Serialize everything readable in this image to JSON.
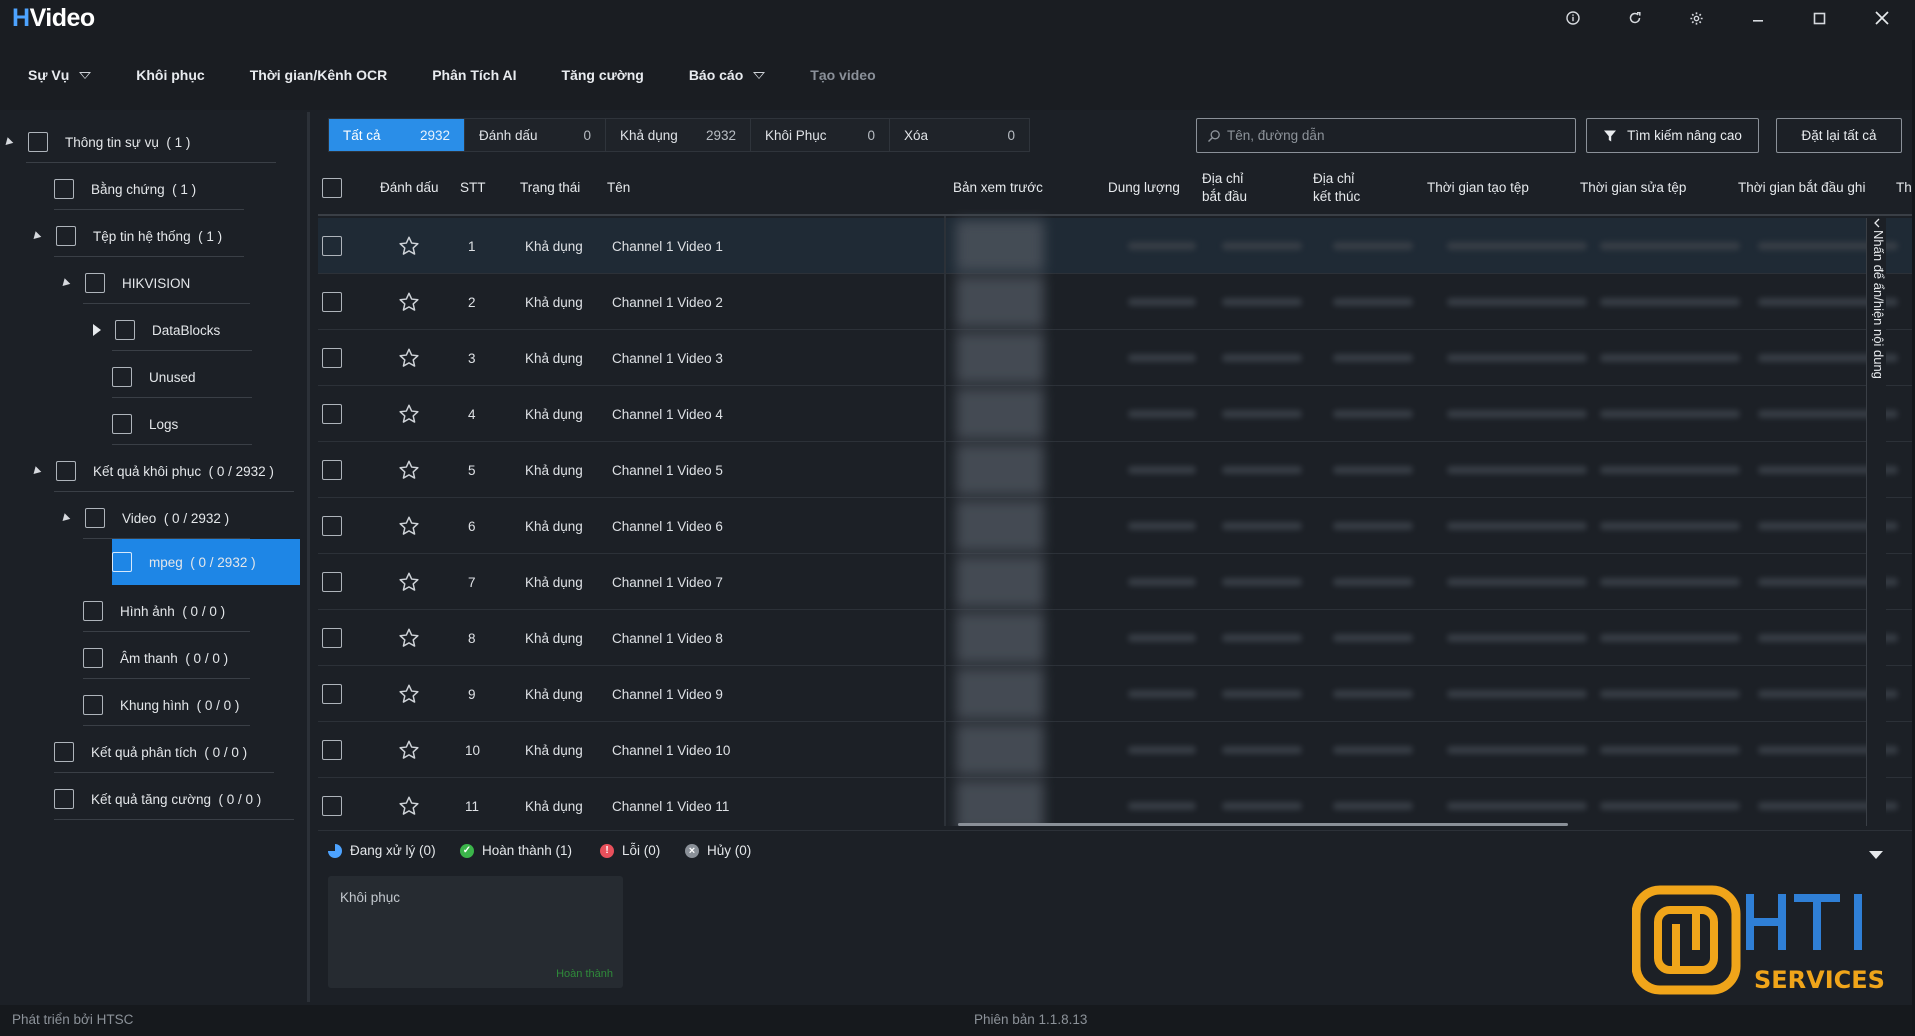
{
  "app": {
    "logo_prefix": "H",
    "logo_rest": "Video"
  },
  "window_controls": [
    "info-icon",
    "refresh-icon",
    "settings-icon",
    "minimize-icon",
    "maximize-icon",
    "close-icon"
  ],
  "menu": {
    "items": [
      {
        "label": "Sự Vụ",
        "dropdown": true
      },
      {
        "label": "Khôi phục",
        "dropdown": false
      },
      {
        "label": "Thời gian/Kênh OCR",
        "dropdown": false
      },
      {
        "label": "Phân Tích AI",
        "dropdown": false
      },
      {
        "label": "Tăng cường",
        "dropdown": false
      },
      {
        "label": "Báo cáo",
        "dropdown": true
      },
      {
        "label": "Tạo video",
        "dropdown": false,
        "disabled": true
      }
    ]
  },
  "tree": {
    "items": [
      {
        "label": "Thông tin sự vụ",
        "count": "( 1 )"
      },
      {
        "label": "Bằng chứng",
        "count": "( 1 )"
      },
      {
        "label": "Tệp tin hệ thống",
        "count": "( 1 )"
      },
      {
        "label": "HIKVISION",
        "count": ""
      },
      {
        "label": "DataBlocks",
        "count": ""
      },
      {
        "label": "Unused",
        "count": ""
      },
      {
        "label": "Logs",
        "count": ""
      },
      {
        "label": "Kết quả khôi phục",
        "count": "( 0 / 2932 )"
      },
      {
        "label": "Video",
        "count": "( 0 / 2932 )"
      },
      {
        "label": "mpeg",
        "count": "( 0 / 2932 )"
      },
      {
        "label": "Hình ảnh",
        "count": "( 0 / 0 )"
      },
      {
        "label": "Âm thanh",
        "count": "( 0 / 0 )"
      },
      {
        "label": "Khung hình",
        "count": "( 0 / 0 )"
      },
      {
        "label": "Kết quả phân tích",
        "count": "( 0 / 0 )"
      },
      {
        "label": "Kết quả tăng cường",
        "count": "( 0 / 0 )"
      }
    ]
  },
  "filters": [
    {
      "label": "Tất cả",
      "count": "2932",
      "active": true
    },
    {
      "label": "Đánh dấu",
      "count": "0"
    },
    {
      "label": "Khả dụng",
      "count": "2932"
    },
    {
      "label": "Khôi Phục",
      "count": "0"
    },
    {
      "label": "Xóa",
      "count": "0"
    }
  ],
  "search": {
    "placeholder": "Tên, đường dẫn"
  },
  "buttons": {
    "advanced_search": "Tìm kiếm nâng cao",
    "reset_all": "Đặt lại tất cả"
  },
  "table": {
    "headers": {
      "mark": "Đánh dấu",
      "stt": "STT",
      "status": "Trạng thái",
      "name": "Tên",
      "preview": "Bản xem trước",
      "size": "Dung lượng",
      "start_addr_1": "Địa chỉ",
      "start_addr_2": "bắt đầu",
      "end_addr_1": "Địa chỉ",
      "end_addr_2": "kết thúc",
      "created": "Thời gian tạo tệp",
      "modified": "Thời gian sửa tệp",
      "rec_start": "Thời gian bắt đầu ghi",
      "more": "Th"
    },
    "rows": [
      {
        "stt": "1",
        "status": "Khả dụng",
        "name": "Channel 1 Video 1"
      },
      {
        "stt": "2",
        "status": "Khả dụng",
        "name": "Channel 1 Video 2"
      },
      {
        "stt": "3",
        "status": "Khả dụng",
        "name": "Channel 1 Video 3"
      },
      {
        "stt": "4",
        "status": "Khả dụng",
        "name": "Channel 1 Video 4"
      },
      {
        "stt": "5",
        "status": "Khả dụng",
        "name": "Channel 1 Video 5"
      },
      {
        "stt": "6",
        "status": "Khả dụng",
        "name": "Channel 1 Video 6"
      },
      {
        "stt": "7",
        "status": "Khả dụng",
        "name": "Channel 1 Video 7"
      },
      {
        "stt": "8",
        "status": "Khả dụng",
        "name": "Channel 1 Video 8"
      },
      {
        "stt": "9",
        "status": "Khả dụng",
        "name": "Channel 1 Video 9"
      },
      {
        "stt": "10",
        "status": "Khả dụng",
        "name": "Channel 1 Video 10"
      },
      {
        "stt": "11",
        "status": "Khả dụng",
        "name": "Channel 1 Video 11"
      }
    ],
    "side_toggle": "Nhấn để ẩn/hiện nội dung"
  },
  "status_bar": {
    "processing": "Đang xử lý (0)",
    "done": "Hoàn thành (1)",
    "error": "Lỗi (0)",
    "cancelled": "Hủy (0)"
  },
  "task_card": {
    "title": "Khôi phục",
    "state": "Hoàn thành"
  },
  "brand": {
    "name": "HTI",
    "sub": "SERVICES"
  },
  "footer": {
    "left": "Phát triển bởi HTSC",
    "version": "Phiên bản 1.1.8.13"
  },
  "colors": {
    "accent": "#2a8ee8",
    "background": "#1c2026",
    "brand_gold": "#f0a51a",
    "brand_blue": "#2f7fd6",
    "success": "#3bb54a",
    "error": "#e8505b"
  }
}
